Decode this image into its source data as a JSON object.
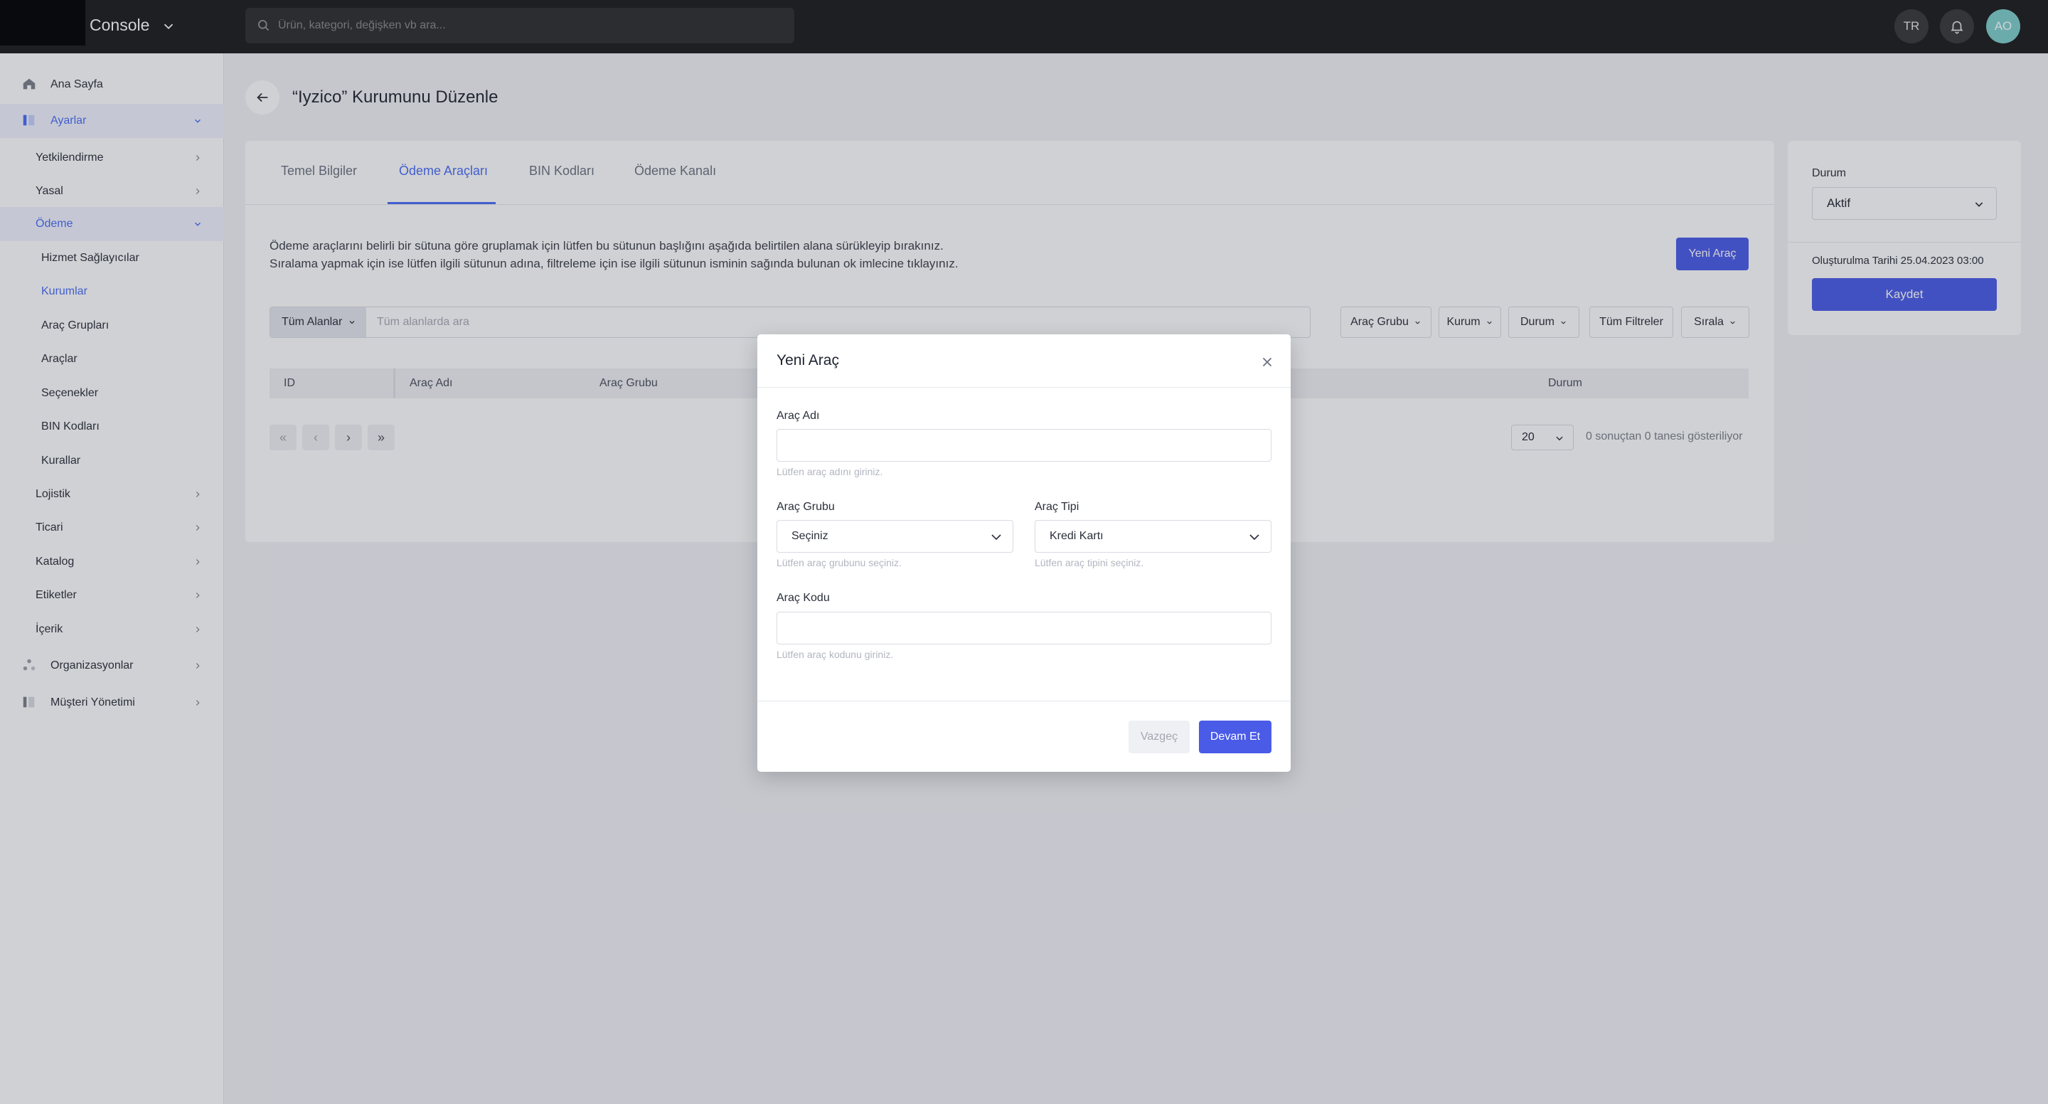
{
  "header": {
    "app_title": "Console",
    "search_placeholder": "Ürün, kategori, değişken vb ara...",
    "language": "TR",
    "user_initials": "AO"
  },
  "sidebar": {
    "items": [
      {
        "label": "Ana Sayfa"
      },
      {
        "label": "Ayarlar"
      },
      {
        "label": "Yetkilendirme"
      },
      {
        "label": "Yasal"
      },
      {
        "label": "Ödeme"
      },
      {
        "label": "Hizmet Sağlayıcılar"
      },
      {
        "label": "Kurumlar"
      },
      {
        "label": "Araç Grupları"
      },
      {
        "label": "Araçlar"
      },
      {
        "label": "Seçenekler"
      },
      {
        "label": "BIN Kodları"
      },
      {
        "label": "Kurallar"
      },
      {
        "label": "Lojistik"
      },
      {
        "label": "Ticari"
      },
      {
        "label": "Katalog"
      },
      {
        "label": "Etiketler"
      },
      {
        "label": "İçerik"
      },
      {
        "label": "Organizasyonlar"
      },
      {
        "label": "Müşteri Yönetimi"
      }
    ]
  },
  "page": {
    "title": "“Iyzico” Kurumunu Düzenle",
    "tabs": [
      {
        "label": "Temel Bilgiler"
      },
      {
        "label": "Ödeme Araçları"
      },
      {
        "label": "BIN Kodları"
      },
      {
        "label": "Ödeme Kanalı"
      }
    ],
    "info_line1": "Ödeme araçlarını belirli bir sütuna göre gruplamak için lütfen bu sütunun başlığını aşağıda belirtilen alana sürükleyip bırakınız.",
    "info_line2": "Sıralama yapmak için ise lütfen ilgili sütunun adına, filtreleme için ise ilgili sütunun isminin sağında bulunan ok imlecine tıklayınız.",
    "new_button": "Yeni Araç",
    "field_select": "Tüm Alanlar",
    "search_placeholder": "Tüm alanlarda ara",
    "filters": [
      "Araç Grubu",
      "Kurum",
      "Durum",
      "Tüm Filtreler",
      "Sırala"
    ],
    "columns": [
      "ID",
      "Araç Adı",
      "Araç Grubu",
      "Durum"
    ],
    "pager": {
      "first": "«",
      "prev": "‹",
      "next": "›",
      "last": "»"
    },
    "page_size": "20",
    "result_text": "0 sonuçtan 0 tanesi gösteriliyor"
  },
  "side_panel": {
    "status_label": "Durum",
    "status_value": "Aktif",
    "created_date": "Oluşturulma Tarihi 25.04.2023 03:00",
    "save_button": "Kaydet"
  },
  "modal": {
    "title": "Yeni Araç",
    "name_label": "Araç Adı",
    "name_value": "",
    "name_help": "Lütfen araç adını giriniz.",
    "group_label": "Araç Grubu",
    "group_value": "Seçiniz",
    "group_help": "Lütfen araç grubunu seçiniz.",
    "type_label": "Araç Tipi",
    "type_value": "Kredi Kartı",
    "type_help": "Lütfen araç tipini seçiniz.",
    "code_label": "Araç Kodu",
    "code_value": "",
    "code_help": "Lütfen araç kodunu giriniz.",
    "cancel_button": "Vazgeç",
    "continue_button": "Devam Et"
  },
  "colors": {
    "accent": "#4a5be8",
    "link": "#4a6cf7",
    "topbar": "#1c1c1c",
    "avatar": "#7ecfcb"
  }
}
